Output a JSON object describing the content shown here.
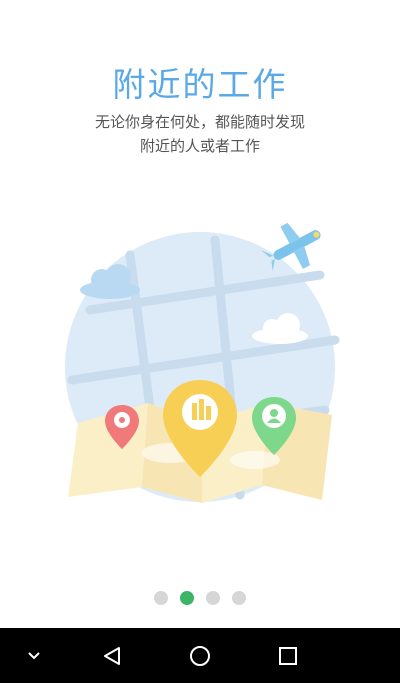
{
  "onboarding": {
    "title": "附近的工作",
    "subtitle_line1": "无论你身在何处，都能随时发现",
    "subtitle_line2": "附近的人或者工作"
  },
  "pager": {
    "total": 4,
    "active_index": 1
  },
  "colors": {
    "title": "#5aa9e6",
    "dot_active": "#3cb567",
    "dot_inactive": "#d6d6d6",
    "pin_yellow": "#f8cf55",
    "pin_green": "#7ed88c",
    "pin_red": "#f07a7a",
    "map_circle": "#dcebf7",
    "navbar": "#000000"
  },
  "icons": {
    "illustration": [
      "cloud-icon",
      "airplane-icon",
      "map-icon",
      "building-pin-icon",
      "person-pin-icon",
      "chat-pin-icon"
    ],
    "navbar": [
      "chevron-down-icon",
      "back-icon",
      "home-icon",
      "recents-icon"
    ]
  }
}
